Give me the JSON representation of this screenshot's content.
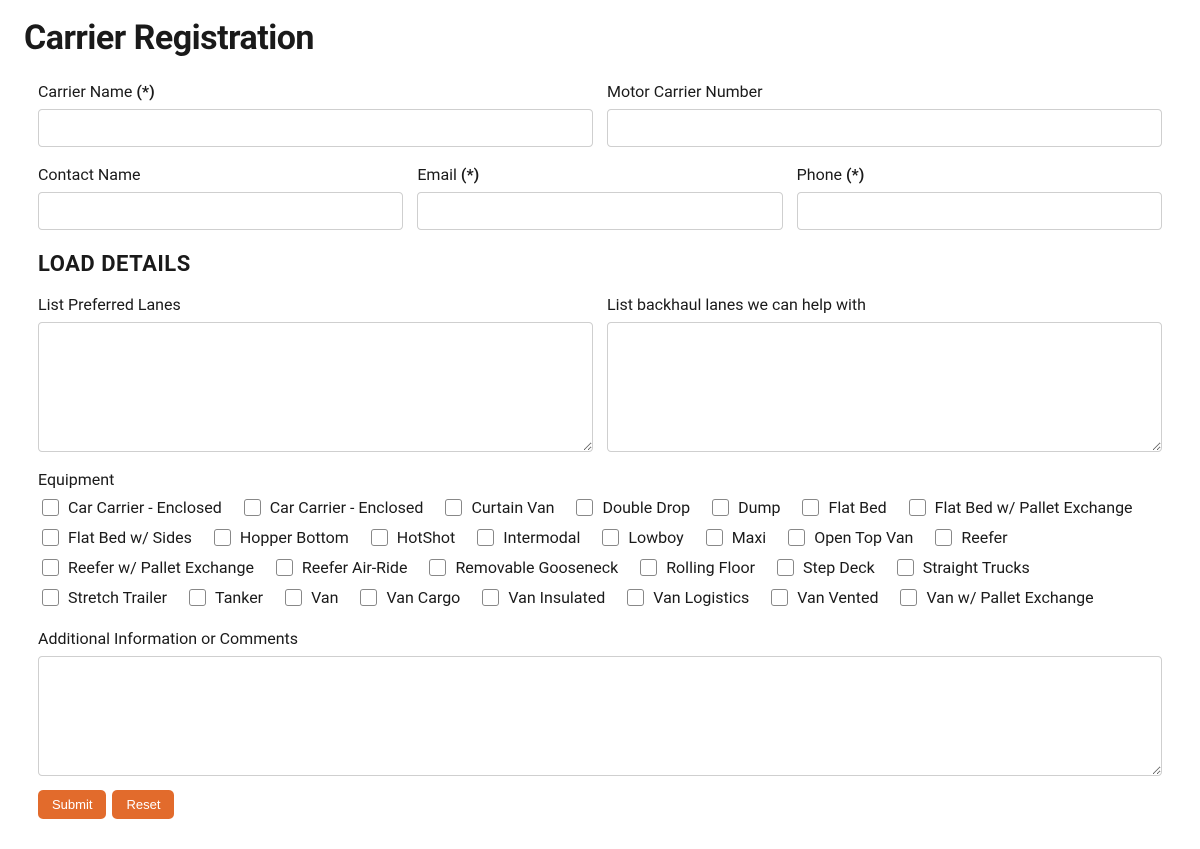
{
  "title": "Carrier Registration",
  "topFields": {
    "carrierName": {
      "label": "Carrier Name",
      "required": "(*)"
    },
    "motorCarrierNumber": {
      "label": "Motor Carrier Number"
    },
    "contactName": {
      "label": "Contact Name"
    },
    "email": {
      "label": "Email",
      "required": "(*)"
    },
    "phone": {
      "label": "Phone",
      "required": "(*)"
    }
  },
  "loadDetails": {
    "heading": "LOAD DETAILS",
    "preferredLanes": {
      "label": "List Preferred Lanes"
    },
    "backhaulLanes": {
      "label": "List backhaul lanes we can help with"
    }
  },
  "equipment": {
    "label": "Equipment",
    "options": [
      "Car Carrier - Enclosed",
      "Car Carrier - Enclosed",
      "Curtain Van",
      "Double Drop",
      "Dump",
      "Flat Bed",
      "Flat Bed w/ Pallet Exchange",
      "Flat Bed w/ Sides",
      "Hopper Bottom",
      "HotShot",
      "Intermodal",
      "Lowboy",
      "Maxi",
      "Open Top Van",
      "Reefer",
      "Reefer w/ Pallet Exchange",
      "Reefer Air-Ride",
      "Removable Gooseneck",
      "Rolling Floor",
      "Step Deck",
      "Straight Trucks",
      "Stretch Trailer",
      "Tanker",
      "Van",
      "Van Cargo",
      "Van Insulated",
      "Van Logistics",
      "Van Vented",
      "Van w/ Pallet Exchange"
    ]
  },
  "additionalInfo": {
    "label": "Additional Information or Comments"
  },
  "buttons": {
    "submit": "Submit",
    "reset": "Reset"
  }
}
